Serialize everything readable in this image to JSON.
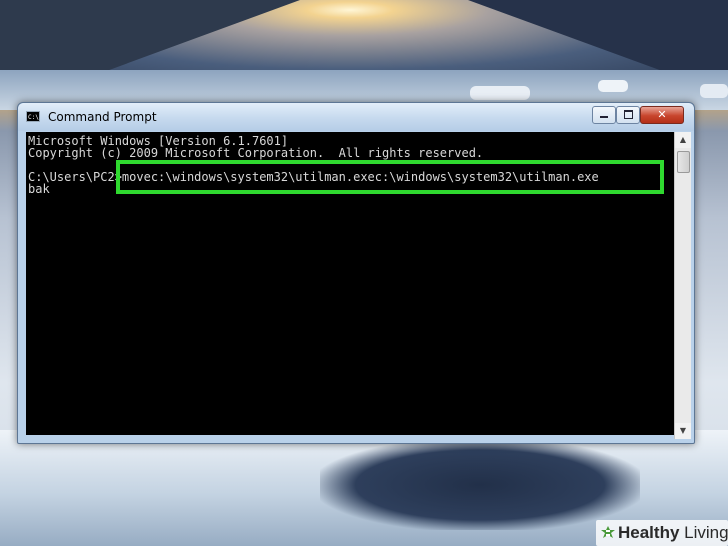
{
  "window": {
    "title": "Command Prompt",
    "icon": "cmd-icon",
    "icon_text": "C:\\",
    "buttons": {
      "minimize": "minimize-icon",
      "maximize": "maximize-icon",
      "close": "✕"
    }
  },
  "console": {
    "lines": [
      "Microsoft Windows [Version 6.1.7601]",
      "Copyright (c) 2009 Microsoft Corporation.  All rights reserved.",
      "C:\\Users\\PC2>movec:\\windows\\system32\\utilman.exec:\\windows\\system32\\utilman.exe",
      "bak"
    ],
    "text_color": "#d8d8d8",
    "background": "#000000",
    "highlight_color": "#2fd92f"
  },
  "watermark": {
    "brand_bold": "Healthy",
    "brand_rest": " Living",
    "icon": "healthy-living-logo-icon"
  }
}
